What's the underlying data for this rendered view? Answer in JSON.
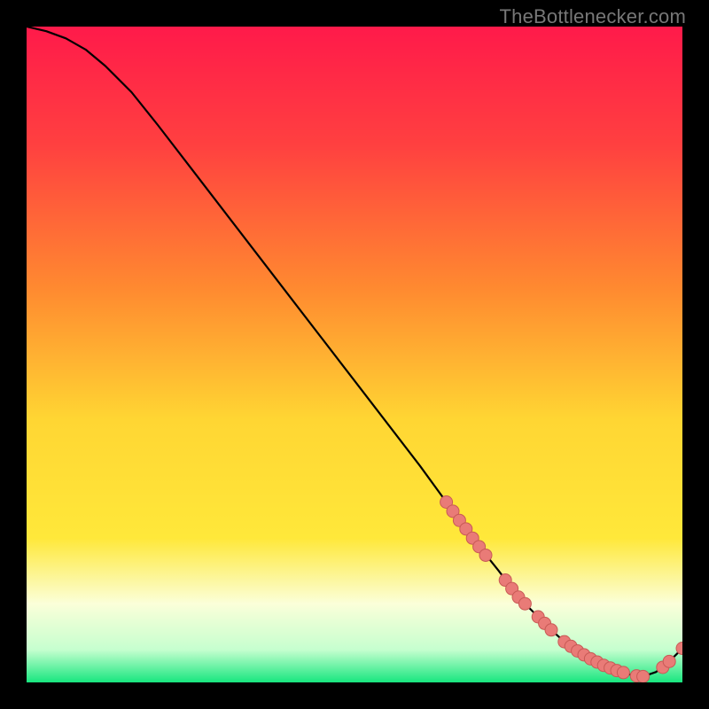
{
  "watermark": "TheBottlenecker.com",
  "colors": {
    "bg": "#000000",
    "grad_top": "#ff1a4a",
    "grad_mid": "#ffb030",
    "grad_yellow": "#ffe83a",
    "grad_pale": "#fbffd9",
    "grad_green": "#18e67f",
    "curve": "#000000",
    "marker_fill": "#e97b77",
    "marker_stroke": "#c85a56"
  },
  "chart_data": {
    "type": "line",
    "title": "",
    "xlabel": "",
    "ylabel": "",
    "xlim": [
      0,
      100
    ],
    "ylim": [
      0,
      100
    ],
    "curve": {
      "x": [
        0,
        3,
        6,
        9,
        12,
        16,
        20,
        25,
        30,
        35,
        40,
        45,
        50,
        55,
        60,
        64,
        68,
        72,
        75,
        78,
        80,
        82,
        84,
        86,
        88,
        90,
        92,
        94,
        96,
        98,
        100
      ],
      "y": [
        100,
        99.3,
        98.2,
        96.5,
        94.0,
        90.0,
        85.0,
        78.5,
        72.0,
        65.5,
        59.0,
        52.5,
        46.0,
        39.5,
        33.0,
        27.5,
        22.0,
        17.0,
        13.0,
        10.0,
        8.0,
        6.2,
        4.8,
        3.6,
        2.6,
        1.8,
        1.2,
        0.9,
        1.6,
        3.2,
        5.2
      ]
    },
    "markers": {
      "x": [
        64,
        65,
        66,
        67,
        68,
        69,
        70,
        73,
        74,
        75,
        76,
        78,
        79,
        80,
        82,
        83,
        84,
        85,
        86,
        87,
        88,
        89,
        90,
        91,
        93,
        94,
        97,
        98,
        100
      ],
      "y": [
        27.5,
        26.1,
        24.7,
        23.4,
        22.0,
        20.7,
        19.4,
        15.6,
        14.3,
        13.0,
        12.0,
        10.0,
        9.0,
        8.0,
        6.2,
        5.5,
        4.8,
        4.2,
        3.6,
        3.1,
        2.6,
        2.2,
        1.8,
        1.5,
        1.0,
        0.9,
        2.3,
        3.2,
        5.2
      ]
    },
    "gradient_stops": [
      {
        "pos": 0.0,
        "color": "#ff1a4a"
      },
      {
        "pos": 0.18,
        "color": "#ff4040"
      },
      {
        "pos": 0.4,
        "color": "#ff8a30"
      },
      {
        "pos": 0.6,
        "color": "#ffd633"
      },
      {
        "pos": 0.78,
        "color": "#ffe83a"
      },
      {
        "pos": 0.88,
        "color": "#fbffd9"
      },
      {
        "pos": 0.95,
        "color": "#c6ffcf"
      },
      {
        "pos": 1.0,
        "color": "#18e67f"
      }
    ]
  }
}
